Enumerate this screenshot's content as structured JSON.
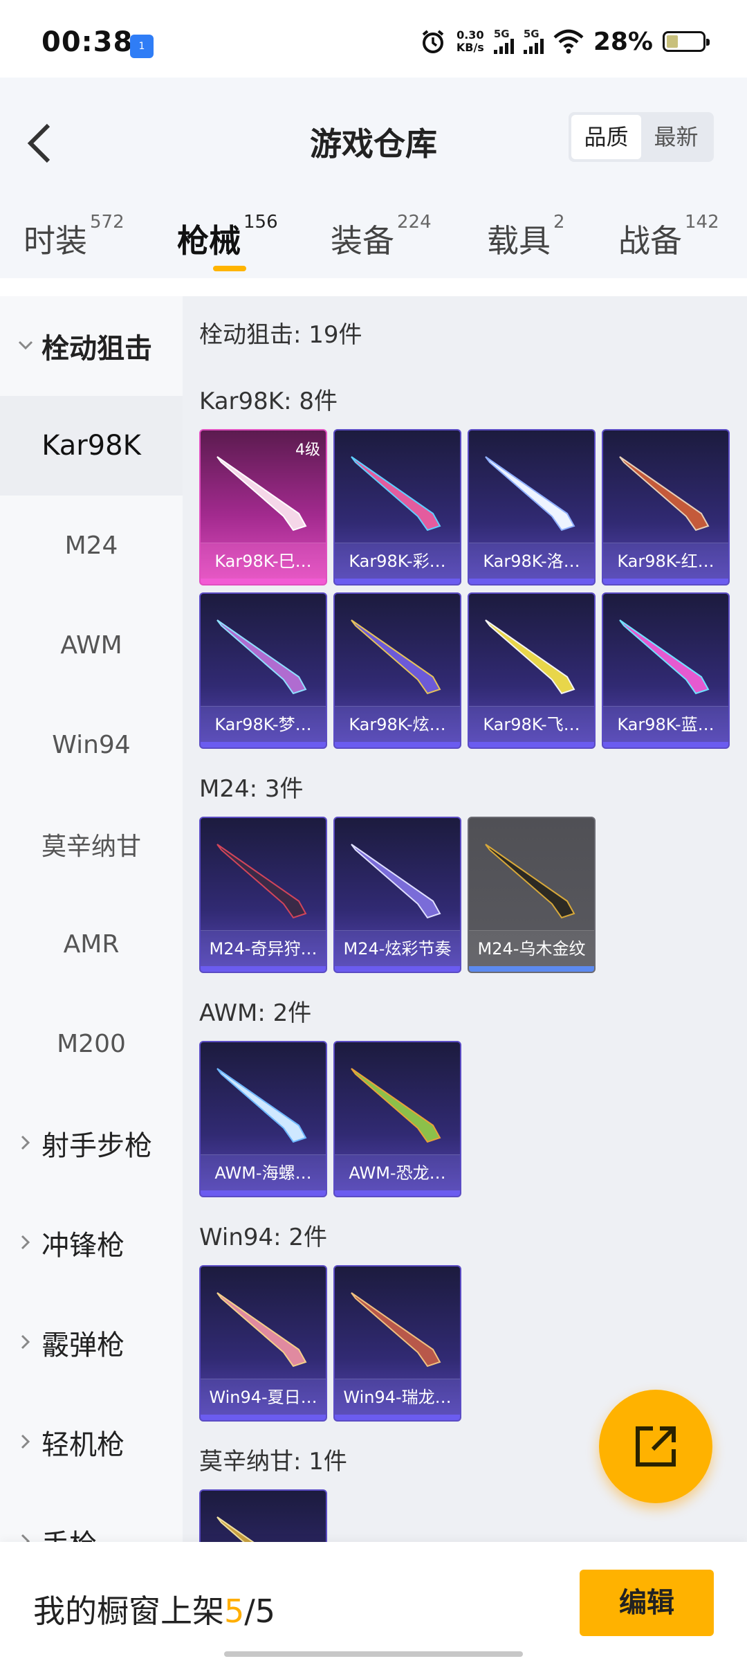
{
  "status_bar": {
    "time": "00:38",
    "badge": "1",
    "net_speed_value": "0.30",
    "net_speed_unit": "KB/s",
    "sim1": "5G",
    "sim2": "5G",
    "battery": "28%",
    "battery_level": 0.28
  },
  "header": {
    "title": "游戏仓库",
    "sort": {
      "quality": "品质",
      "newest": "最新"
    }
  },
  "tabs": [
    {
      "label": "时装",
      "count": "572"
    },
    {
      "label": "枪械",
      "count": "156"
    },
    {
      "label": "装备",
      "count": "224"
    },
    {
      "label": "载具",
      "count": "2"
    },
    {
      "label": "战备",
      "count": "142"
    }
  ],
  "sidebar": {
    "category_open": "栓动狙击",
    "subitems": [
      "Kar98K",
      "M24",
      "AWM",
      "Win94",
      "莫辛纳甘",
      "AMR",
      "M200"
    ],
    "categories": [
      "射手步枪",
      "冲锋枪",
      "霰弹枪",
      "轻机枪",
      "手枪"
    ]
  },
  "content": {
    "summary": "栓动狙击: 19件",
    "sections": [
      {
        "title": "Kar98K: 8件",
        "items": [
          {
            "name": "Kar98K-巳…",
            "level": "4级"
          },
          {
            "name": "Kar98K-彩…"
          },
          {
            "name": "Kar98K-洛…"
          },
          {
            "name": "Kar98K-红…"
          },
          {
            "name": "Kar98K-梦…"
          },
          {
            "name": "Kar98K-炫…"
          },
          {
            "name": "Kar98K-飞…"
          },
          {
            "name": "Kar98K-蓝…"
          }
        ]
      },
      {
        "title": "M24: 3件",
        "items": [
          {
            "name": "M24-奇异狩…"
          },
          {
            "name": "M24-炫彩节奏"
          },
          {
            "name": "M24-乌木金纹"
          }
        ]
      },
      {
        "title": "AWM: 2件",
        "items": [
          {
            "name": "AWM-海螺…"
          },
          {
            "name": "AWM-恐龙…"
          }
        ]
      },
      {
        "title": "Win94: 2件",
        "items": [
          {
            "name": "Win94-夏日…"
          },
          {
            "name": "Win94-瑞龙…"
          }
        ]
      },
      {
        "title": "莫辛纳甘: 1件",
        "items": []
      }
    ]
  },
  "bottom_bar": {
    "label": "我的橱窗上架",
    "current": "5",
    "sep": "/",
    "total": "5",
    "edit": "编辑"
  },
  "colors": {
    "accent": "#ffb200",
    "card_purple": "#312a73",
    "card_pink": "#e14fc0",
    "card_gray": "#5a5a60"
  }
}
